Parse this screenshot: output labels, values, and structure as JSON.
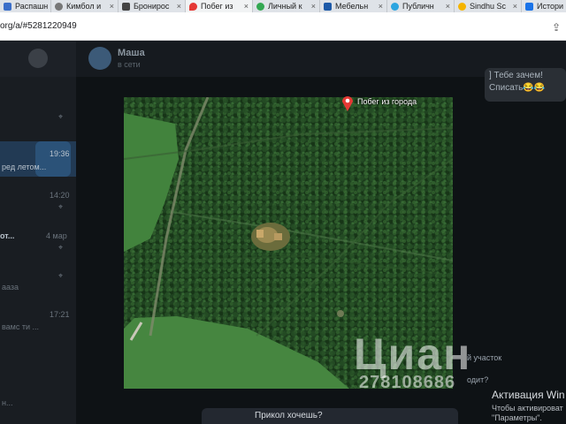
{
  "browser": {
    "tabs": [
      {
        "label": "Распашн",
        "icon": "blue-square-icon",
        "color": "#3b6fc9"
      },
      {
        "label": "Кимбол и",
        "icon": "globe-icon",
        "color": "#555555"
      },
      {
        "label": "Бронирос",
        "icon": "bus-icon",
        "color": "#444444"
      },
      {
        "label": "Побег из",
        "icon": "map-pin-icon",
        "color": "#e53935"
      },
      {
        "label": "Личный к",
        "icon": "cloud-icon",
        "color": "#33a852"
      },
      {
        "label": "Мебельн",
        "icon": "chart-icon",
        "color": "#1e5aa8"
      },
      {
        "label": "Публичн",
        "icon": "telegram-icon",
        "color": "#2ca5e0"
      },
      {
        "label": "Sindhu Sc",
        "icon": "sun-icon",
        "color": "#f5b400"
      },
      {
        "label": "Истори",
        "icon": "download-icon",
        "color": "#1a73e8"
      }
    ],
    "url": "org/a/#5281220949"
  },
  "sidebar": {
    "times": [
      "19:36",
      "14:20",
      "4 мар",
      "17:21"
    ],
    "snippets": [
      "ред летом...",
      "от...",
      "ааза",
      "вамс ти ...",
      "н..."
    ]
  },
  "chat": {
    "name": "Маша",
    "status": "в сети",
    "messages": [
      "] Тебе зачем!",
      "Списать😂😂"
    ],
    "right_fragments": [
      "й участок",
      "одит?"
    ]
  },
  "photo": {
    "pin_label": "Побег из города",
    "watermark": "Циан",
    "watermark_id": "278108686"
  },
  "caption": "Прикол хочешь?",
  "windows_activation": {
    "title": "Активация Win",
    "line1": "Чтобы активироват",
    "line2": "\"Параметры\"."
  },
  "colors": {
    "map_forest": "#244a22",
    "field": "#3c7a3a",
    "pin": "#e53935"
  }
}
